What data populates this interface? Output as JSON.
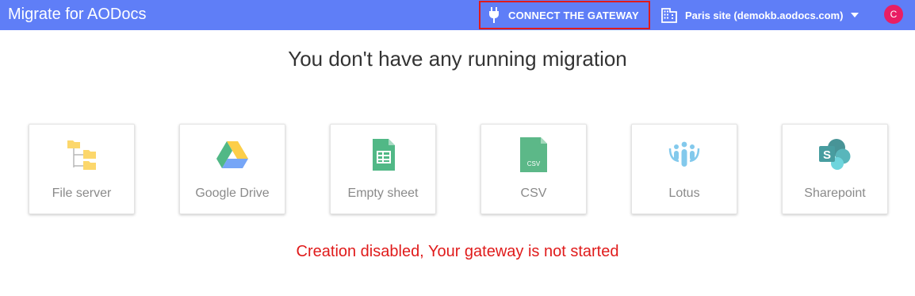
{
  "header": {
    "app_title": "Migrate for AODocs",
    "gateway_button_label": "CONNECT THE GATEWAY",
    "site_label": "Paris site (demokb.aodocs.com)",
    "avatar_initial": "C",
    "colors": {
      "bar": "#5f7ef7",
      "highlight_border": "#e01b1b",
      "avatar": "#e91e63"
    }
  },
  "main": {
    "heading": "You don't have any running migration",
    "sources": [
      {
        "label": "File server",
        "icon": "folder-tree-icon"
      },
      {
        "label": "Google Drive",
        "icon": "google-drive-icon"
      },
      {
        "label": "Empty sheet",
        "icon": "spreadsheet-icon"
      },
      {
        "label": "CSV",
        "icon": "csv-file-icon"
      },
      {
        "label": "Lotus",
        "icon": "lotus-icon"
      },
      {
        "label": "Sharepoint",
        "icon": "sharepoint-icon"
      }
    ],
    "error_message": "Creation disabled, Your gateway is not started",
    "error_color": "#e01b1b"
  },
  "icons": {
    "csv_icon_text": "CSV",
    "sharepoint_icon_text": "S"
  }
}
